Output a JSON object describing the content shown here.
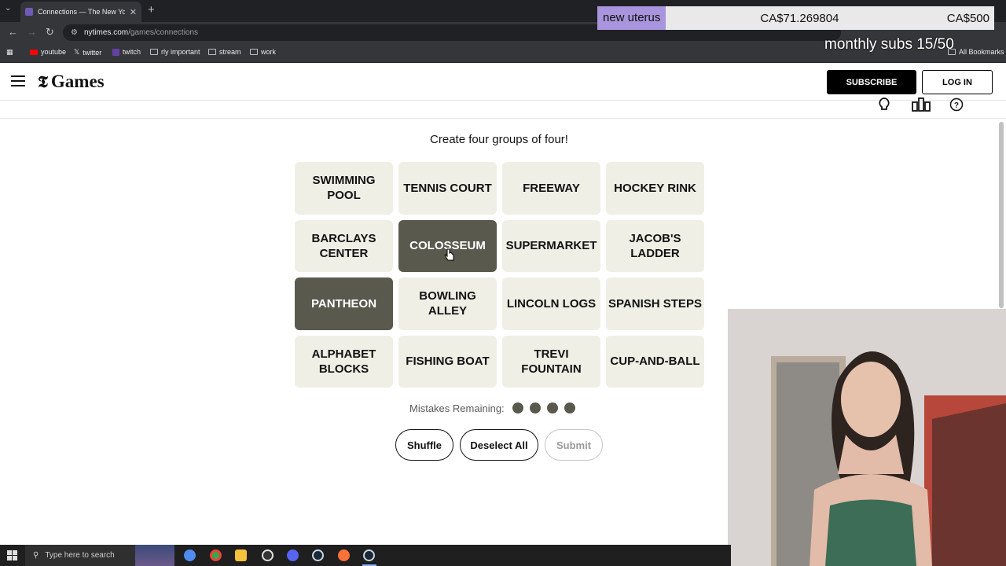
{
  "browser": {
    "tab_title": "Connections — The New York T",
    "url_host": "nytimes.com",
    "url_path": "/games/connections",
    "bookmarks": [
      "youtube",
      "twitter",
      "twitch",
      "rly important",
      "stream",
      "work"
    ],
    "all_bookmarks": "All Bookmarks"
  },
  "overlay": {
    "donor": "new uterus",
    "amount": "CA$71.269804",
    "goal": "CA$500",
    "subs": "monthly subs 15/50"
  },
  "header": {
    "logo": "Games",
    "subscribe": "SUBSCRIBE",
    "login": "LOG IN"
  },
  "game": {
    "instructions": "Create four groups of four!",
    "tiles": [
      {
        "label": "SWIMMING POOL",
        "selected": false
      },
      {
        "label": "TENNIS COURT",
        "selected": false
      },
      {
        "label": "FREEWAY",
        "selected": false
      },
      {
        "label": "HOCKEY RINK",
        "selected": false
      },
      {
        "label": "BARCLAYS CENTER",
        "selected": false
      },
      {
        "label": "COLOSSEUM",
        "selected": true
      },
      {
        "label": "SUPERMARKET",
        "selected": false
      },
      {
        "label": "JACOB'S LADDER",
        "selected": false
      },
      {
        "label": "PANTHEON",
        "selected": true
      },
      {
        "label": "BOWLING ALLEY",
        "selected": false
      },
      {
        "label": "LINCOLN LOGS",
        "selected": false
      },
      {
        "label": "SPANISH STEPS",
        "selected": false
      },
      {
        "label": "ALPHABET BLOCKS",
        "selected": false
      },
      {
        "label": "FISHING BOAT",
        "selected": false
      },
      {
        "label": "TREVI FOUNTAIN",
        "selected": false
      },
      {
        "label": "CUP-AND-BALL",
        "selected": false
      }
    ],
    "mistakes_label": "Mistakes Remaining:",
    "mistakes_remaining": 4,
    "buttons": {
      "shuffle": "Shuffle",
      "deselect": "Deselect All",
      "submit": "Submit"
    }
  },
  "taskbar": {
    "search_placeholder": "Type here to search"
  },
  "colors": {
    "tile": "#efefe6",
    "tile_selected": "#5a594e",
    "donor_highlight": "#a995dd"
  }
}
